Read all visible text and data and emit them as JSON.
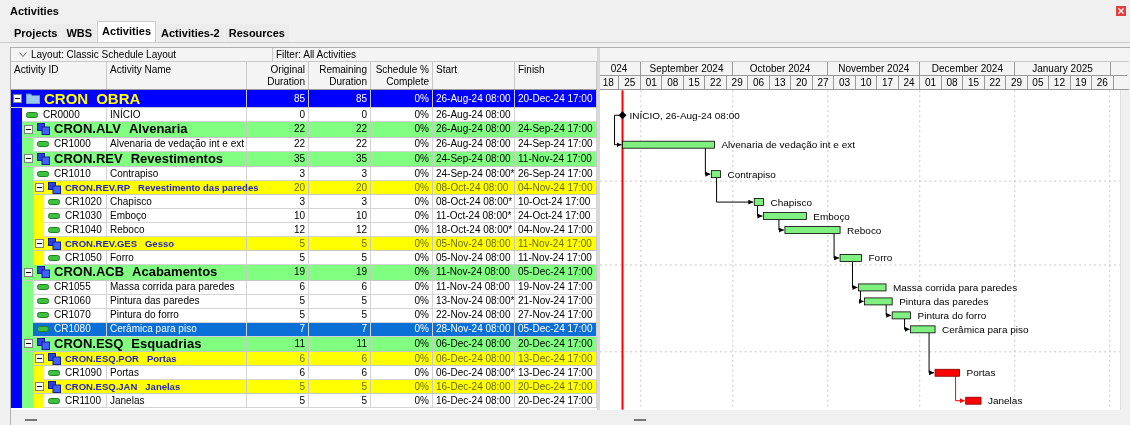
{
  "panel": {
    "title": "Activities"
  },
  "tabs": [
    {
      "label": "Projects",
      "selected": false
    },
    {
      "label": "WBS",
      "selected": false
    },
    {
      "label": "Activities",
      "selected": true
    },
    {
      "label": "Activities-2",
      "selected": false
    },
    {
      "label": "Resources",
      "selected": false
    }
  ],
  "toolbar": {
    "layout": "Layout: Classic Schedule Layout",
    "filter": "Filter: All Activities"
  },
  "table": {
    "columns": [
      "Activity ID",
      "Activity Name",
      "Original Duration",
      "Remaining Duration",
      "Schedule % Complete",
      "Start",
      "Finish"
    ],
    "rows": [
      {
        "kind": "project",
        "code": "CRON",
        "name": "OBRA",
        "color": "#0000ff",
        "expanded": true,
        "original_duration": "85",
        "remaining_duration": "85",
        "schedule_pct": "0%",
        "start": "26-Aug-24 08:00",
        "finish": "20-Dec-24 17:00",
        "children": [
          {
            "kind": "activity",
            "id": "CR0000",
            "name": "INÍCIO",
            "original_duration": "0",
            "remaining_duration": "0",
            "schedule_pct": "0%",
            "start": "26-Aug-24 08:00",
            "selected": false,
            "milestone": true,
            "critical": false,
            "bar_label": "INÍCIO, 26-Aug-24 08:00"
          },
          {
            "kind": "wbs",
            "code": "CRON.ALV",
            "name": "Alvenaria",
            "color": "#80ff80",
            "expanded": true,
            "original_duration": "22",
            "remaining_duration": "22",
            "schedule_pct": "0%",
            "start": "26-Aug-24 08:00",
            "finish": "24-Sep-24 17:00",
            "children": [
              {
                "kind": "activity",
                "id": "CR1000",
                "name": "Alvenaria de vedação int e ext",
                "original_duration": "22",
                "remaining_duration": "22",
                "schedule_pct": "0%",
                "start": "26-Aug-24 08:00",
                "finish": "24-Sep-24 17:00",
                "selected": false,
                "milestone": false,
                "critical": false,
                "bar_label": "Alvenaria de vedação int e ext"
              }
            ]
          },
          {
            "kind": "wbs",
            "code": "CRON.REV",
            "name": "Revestimentos",
            "color": "#80ff80",
            "expanded": true,
            "original_duration": "35",
            "remaining_duration": "35",
            "schedule_pct": "0%",
            "start": "24-Sep-24 08:00",
            "finish": "11-Nov-24 17:00",
            "children": [
              {
                "kind": "activity",
                "id": "CR1010",
                "name": "Contrapiso",
                "original_duration": "3",
                "remaining_duration": "3",
                "schedule_pct": "0%",
                "start": "24-Sep-24 08:00*",
                "finish": "26-Sep-24 17:00",
                "selected": false,
                "milestone": false,
                "critical": false,
                "bar_label": "Contrapiso"
              },
              {
                "kind": "wbs",
                "code": "CRON.REV.RP",
                "name": "Revestimento das paredes",
                "color": "#ffff00",
                "expanded": true,
                "original_duration": "20",
                "remaining_duration": "20",
                "schedule_pct": "0%",
                "start": "08-Oct-24 08:00",
                "finish": "04-Nov-24 17:00",
                "children": [
                  {
                    "kind": "activity",
                    "id": "CR1020",
                    "name": "Chapisco",
                    "original_duration": "3",
                    "remaining_duration": "3",
                    "schedule_pct": "0%",
                    "start": "08-Oct-24 08:00*",
                    "finish": "10-Oct-24 17:00",
                    "selected": false,
                    "milestone": false,
                    "critical": false,
                    "bar_label": "Chapisco"
                  },
                  {
                    "kind": "activity",
                    "id": "CR1030",
                    "name": "Emboço",
                    "original_duration": "10",
                    "remaining_duration": "10",
                    "schedule_pct": "0%",
                    "start": "11-Oct-24 08:00*",
                    "finish": "24-Oct-24 17:00",
                    "selected": false,
                    "milestone": false,
                    "critical": false,
                    "bar_label": "Emboço"
                  },
                  {
                    "kind": "activity",
                    "id": "CR1040",
                    "name": "Reboco",
                    "original_duration": "12",
                    "remaining_duration": "12",
                    "schedule_pct": "0%",
                    "start": "18-Oct-24 08:00*",
                    "finish": "04-Nov-24 17:00",
                    "selected": false,
                    "milestone": false,
                    "critical": false,
                    "bar_label": "Reboco"
                  }
                ]
              },
              {
                "kind": "wbs",
                "code": "CRON.REV.GES",
                "name": "Gesso",
                "color": "#ffff00",
                "expanded": true,
                "original_duration": "5",
                "remaining_duration": "5",
                "schedule_pct": "0%",
                "start": "05-Nov-24 08:00",
                "finish": "11-Nov-24 17:00",
                "children": [
                  {
                    "kind": "activity",
                    "id": "CR1050",
                    "name": "Forro",
                    "original_duration": "5",
                    "remaining_duration": "5",
                    "schedule_pct": "0%",
                    "start": "05-Nov-24 08:00",
                    "finish": "11-Nov-24 17:00",
                    "selected": false,
                    "milestone": false,
                    "critical": false,
                    "bar_label": "Forro"
                  }
                ]
              }
            ]
          },
          {
            "kind": "wbs",
            "code": "CRON.ACB",
            "name": "Acabamentos",
            "color": "#80ff80",
            "expanded": true,
            "original_duration": "19",
            "remaining_duration": "19",
            "schedule_pct": "0%",
            "start": "11-Nov-24 08:00",
            "finish": "05-Dec-24 17:00",
            "children": [
              {
                "kind": "activity",
                "id": "CR1055",
                "name": "Massa corrida para paredes",
                "original_duration": "6",
                "remaining_duration": "6",
                "schedule_pct": "0%",
                "start": "11-Nov-24 08:00",
                "finish": "19-Nov-24 17:00",
                "selected": false,
                "milestone": false,
                "critical": false,
                "bar_label": "Massa corrida para paredes"
              },
              {
                "kind": "activity",
                "id": "CR1060",
                "name": "Pintura das paredes",
                "original_duration": "5",
                "remaining_duration": "5",
                "schedule_pct": "0%",
                "start": "13-Nov-24 08:00*",
                "finish": "21-Nov-24 17:00",
                "selected": false,
                "milestone": false,
                "critical": false,
                "bar_label": "Pintura das paredes"
              },
              {
                "kind": "activity",
                "id": "CR1070",
                "name": "Pintura do forro",
                "original_duration": "5",
                "remaining_duration": "5",
                "schedule_pct": "0%",
                "start": "22-Nov-24 08:00",
                "finish": "27-Nov-24 17:00",
                "selected": false,
                "milestone": false,
                "critical": false,
                "bar_label": "Pintura do forro"
              },
              {
                "kind": "activity",
                "id": "CR1080",
                "name": "Cerâmica para piso",
                "original_duration": "7",
                "remaining_duration": "7",
                "schedule_pct": "0%",
                "start": "28-Nov-24 08:00",
                "finish": "05-Dec-24 17:00",
                "selected": true,
                "milestone": false,
                "critical": false,
                "bar_label": "Cerâmica para piso"
              }
            ]
          },
          {
            "kind": "wbs",
            "code": "CRON.ESQ",
            "name": "Esquadrias",
            "color": "#80ff80",
            "expanded": true,
            "original_duration": "11",
            "remaining_duration": "11",
            "schedule_pct": "0%",
            "start": "06-Dec-24 08:00",
            "finish": "20-Dec-24 17:00",
            "children": [
              {
                "kind": "wbs",
                "code": "CRON.ESQ.POR",
                "name": "Portas",
                "color": "#ffff00",
                "expanded": true,
                "original_duration": "6",
                "remaining_duration": "6",
                "schedule_pct": "0%",
                "start": "06-Dec-24 08:00",
                "finish": "13-Dec-24 17:00",
                "children": [
                  {
                    "kind": "activity",
                    "id": "CR1090",
                    "name": "Portas",
                    "original_duration": "6",
                    "remaining_duration": "6",
                    "schedule_pct": "0%",
                    "start": "06-Dec-24 08:00*",
                    "finish": "13-Dec-24 17:00",
                    "selected": false,
                    "milestone": false,
                    "critical": true,
                    "bar_label": "Portas"
                  }
                ]
              },
              {
                "kind": "wbs",
                "code": "CRON.ESQ.JAN",
                "name": "Janelas",
                "color": "#ffff00",
                "expanded": true,
                "original_duration": "5",
                "remaining_duration": "5",
                "schedule_pct": "0%",
                "start": "16-Dec-24 08:00",
                "finish": "20-Dec-24 17:00",
                "children": [
                  {
                    "kind": "activity",
                    "id": "CR1100",
                    "name": "Janelas",
                    "original_duration": "5",
                    "remaining_duration": "5",
                    "schedule_pct": "0%",
                    "start": "16-Dec-24 08:00",
                    "finish": "20-Dec-24 17:00",
                    "selected": false,
                    "milestone": false,
                    "critical": true,
                    "bar_label": "Janelas"
                  }
                ]
              }
            ]
          }
        ]
      }
    ]
  },
  "gantt": {
    "months": [
      "024",
      "September 2024",
      "October 2024",
      "November 2024",
      "December 2024",
      "January 2025"
    ],
    "weeks": [
      "18",
      "25",
      "01",
      "08",
      "15",
      "22",
      "29",
      "06",
      "13",
      "20",
      "27",
      "03",
      "10",
      "17",
      "24",
      "01",
      "08",
      "15",
      "22",
      "29",
      "05",
      "12",
      "19",
      "26"
    ]
  }
}
